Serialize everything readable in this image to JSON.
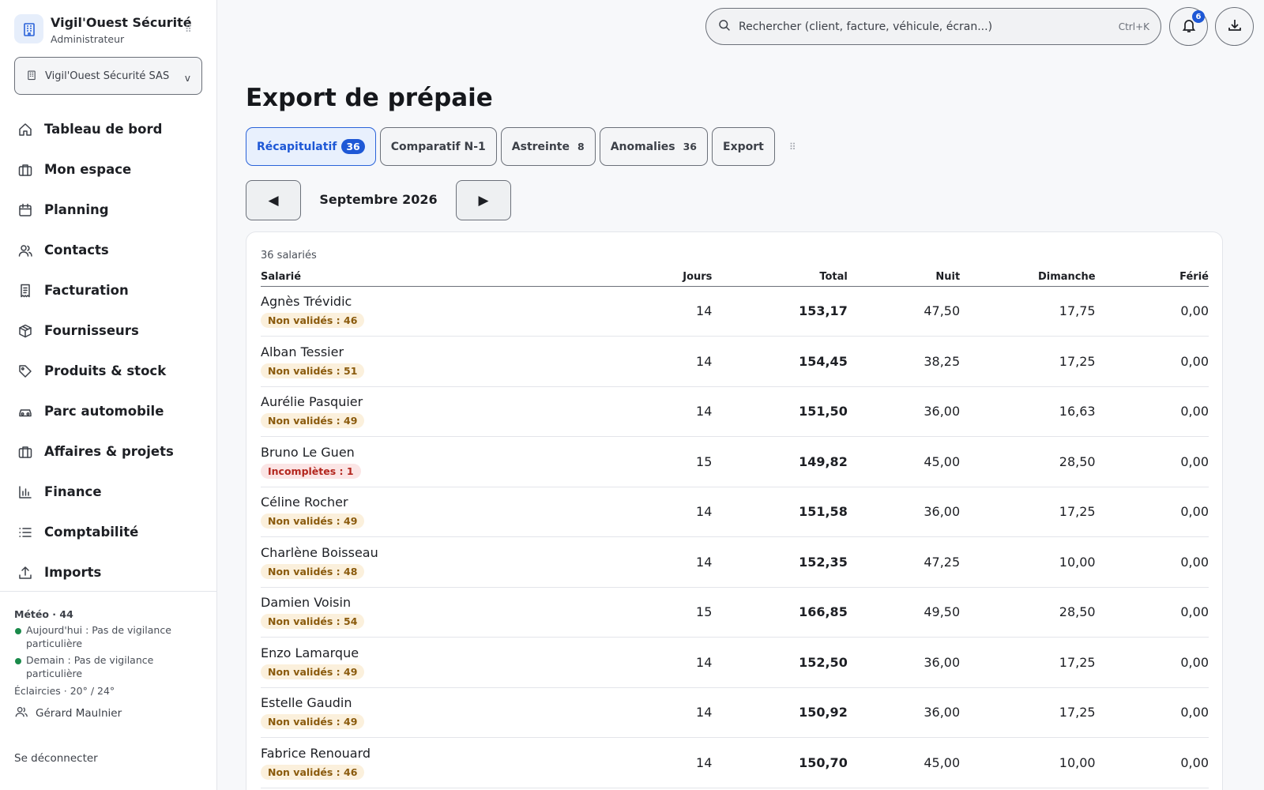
{
  "app": {
    "name": "Vigil'Ouest Sécurité",
    "role": "Administrateur",
    "company": "Vigil'Ouest Sécurité SAS",
    "company_chevron": "v"
  },
  "nav": [
    {
      "label": "Tableau de bord",
      "icon": "home-icon"
    },
    {
      "label": "Mon espace",
      "icon": "briefcase-icon"
    },
    {
      "label": "Planning",
      "icon": "calendar-icon"
    },
    {
      "label": "Contacts",
      "icon": "users-icon"
    },
    {
      "label": "Facturation",
      "icon": "invoice-icon"
    },
    {
      "label": "Fournisseurs",
      "icon": "box-icon"
    },
    {
      "label": "Produits & stock",
      "icon": "tag-icon"
    },
    {
      "label": "Parc automobile",
      "icon": "car-icon"
    },
    {
      "label": "Affaires & projets",
      "icon": "briefcase-icon"
    },
    {
      "label": "Finance",
      "icon": "bar-chart-icon"
    },
    {
      "label": "Comptabilité",
      "icon": "list-icon"
    },
    {
      "label": "Imports",
      "icon": "upload-icon"
    }
  ],
  "weather": {
    "title": "Météo · 44",
    "today": "Aujourd'hui : Pas de vigilance particulière",
    "tomorrow": "Demain : Pas de vigilance particulière",
    "conditions": "Éclaircies · 20° / 24°"
  },
  "user": {
    "name": "Gérard Maulnier"
  },
  "logout_label": "Se déconnecter",
  "search": {
    "placeholder": "Rechercher (client, facture, véhicule, écran...)",
    "shortcut": "Ctrl+K"
  },
  "notifications": {
    "count": "6"
  },
  "page": {
    "title": "Export de prépaie"
  },
  "tabs": [
    {
      "label": "Récapitulatif",
      "count": "36",
      "active": true
    },
    {
      "label": "Comparatif N-1",
      "count": ""
    },
    {
      "label": "Astreinte",
      "count": "8"
    },
    {
      "label": "Anomalies",
      "count": "36"
    },
    {
      "label": "Export",
      "count": ""
    }
  ],
  "period": {
    "label": "Septembre 2026",
    "prev": "◀",
    "next": "▶"
  },
  "table": {
    "count_label": "36 salariés",
    "columns": [
      "Salarié",
      "Jours",
      "Total",
      "Nuit",
      "Dimanche",
      "Férié"
    ],
    "rows": [
      {
        "name": "Agnès Trévidic",
        "status": "Non validés : 46",
        "status_type": "warn",
        "jours": "14",
        "total": "153,17",
        "nuit": "47,50",
        "dimanche": "17,75",
        "ferie": "0,00"
      },
      {
        "name": "Alban Tessier",
        "status": "Non validés : 51",
        "status_type": "warn",
        "jours": "14",
        "total": "154,45",
        "nuit": "38,25",
        "dimanche": "17,25",
        "ferie": "0,00"
      },
      {
        "name": "Aurélie Pasquier",
        "status": "Non validés : 49",
        "status_type": "warn",
        "jours": "14",
        "total": "151,50",
        "nuit": "36,00",
        "dimanche": "16,63",
        "ferie": "0,00"
      },
      {
        "name": "Bruno Le Guen",
        "status": "Incomplètes : 1",
        "status_type": "err",
        "jours": "15",
        "total": "149,82",
        "nuit": "45,00",
        "dimanche": "28,50",
        "ferie": "0,00"
      },
      {
        "name": "Céline Rocher",
        "status": "Non validés : 49",
        "status_type": "warn",
        "jours": "14",
        "total": "151,58",
        "nuit": "36,00",
        "dimanche": "17,25",
        "ferie": "0,00"
      },
      {
        "name": "Charlène Boisseau",
        "status": "Non validés : 48",
        "status_type": "warn",
        "jours": "14",
        "total": "152,35",
        "nuit": "47,25",
        "dimanche": "10,00",
        "ferie": "0,00"
      },
      {
        "name": "Damien Voisin",
        "status": "Non validés : 54",
        "status_type": "warn",
        "jours": "15",
        "total": "166,85",
        "nuit": "49,50",
        "dimanche": "28,50",
        "ferie": "0,00"
      },
      {
        "name": "Enzo Lamarque",
        "status": "Non validés : 49",
        "status_type": "warn",
        "jours": "14",
        "total": "152,50",
        "nuit": "36,00",
        "dimanche": "17,25",
        "ferie": "0,00"
      },
      {
        "name": "Estelle Gaudin",
        "status": "Non validés : 49",
        "status_type": "warn",
        "jours": "14",
        "total": "150,92",
        "nuit": "36,00",
        "dimanche": "17,25",
        "ferie": "0,00"
      },
      {
        "name": "Fabrice Renouard",
        "status": "Non validés : 46",
        "status_type": "warn",
        "jours": "14",
        "total": "150,70",
        "nuit": "45,00",
        "dimanche": "10,00",
        "ferie": "0,00"
      }
    ]
  },
  "colors": {
    "accent": "#1e58d6",
    "warn_bg": "#fbf0dc",
    "warn_fg": "#8a5a0c",
    "err_bg": "#fbe5e5",
    "err_fg": "#b3261e",
    "weather_ok": "#1a8a4a"
  }
}
